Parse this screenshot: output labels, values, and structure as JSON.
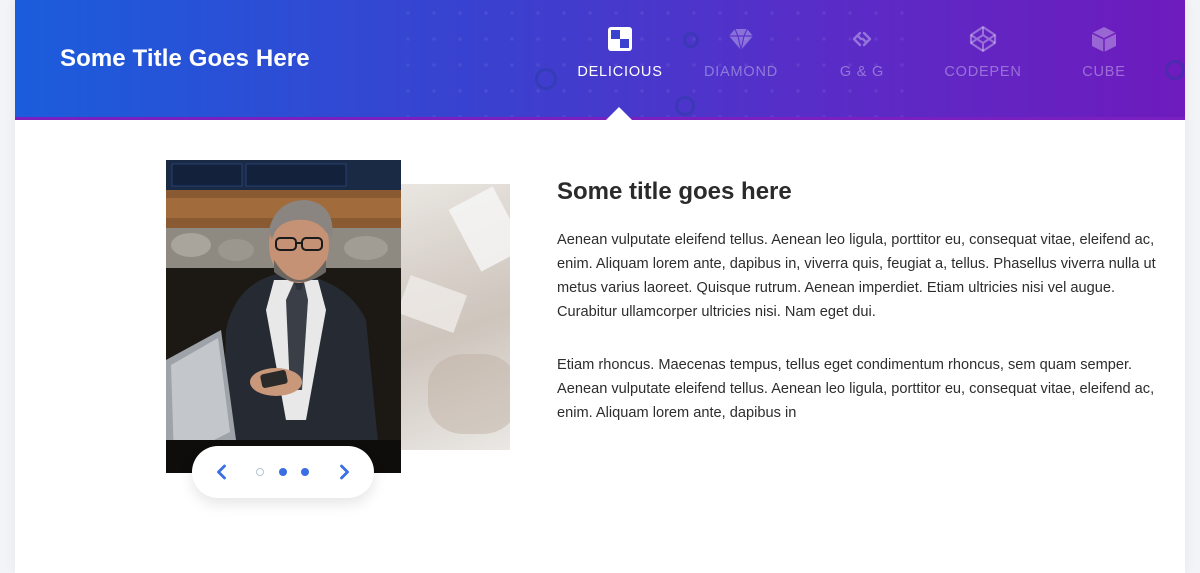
{
  "header": {
    "title": "Some Title Goes Here",
    "tabs": [
      {
        "label": "DELICIOUS",
        "icon": "checker-square-icon",
        "active": true
      },
      {
        "label": "DIAMOND",
        "icon": "diamond-icon",
        "active": false
      },
      {
        "label": "G & G",
        "icon": "chain-link-icon",
        "active": false
      },
      {
        "label": "CODEPEN",
        "icon": "codepen-icon",
        "active": false
      },
      {
        "label": "CUBE",
        "icon": "cube-icon",
        "active": false
      }
    ]
  },
  "slider": {
    "prev_icon": "chevron-left-icon",
    "next_icon": "chevron-right-icon",
    "dots": 3,
    "active_dot": 0
  },
  "content": {
    "title": "Some title goes here",
    "paragraph_1": "Aenean vulputate eleifend tellus. Aenean leo ligula, porttitor eu, consequat vitae, eleifend ac, enim. Aliquam lorem ante, dapibus in, viverra quis, feugiat a, tellus. Phasellus viverra nulla ut metus varius laoreet. Quisque rutrum. Aenean imperdiet. Etiam ultricies nisi vel augue. Curabitur ullamcorper ultricies nisi. Nam eget dui.",
    "paragraph_2": "Etiam rhoncus. Maecenas tempus, tellus eget condimentum rhoncus, sem quam semper. Aenean vulputate eleifend tellus. Aenean leo ligula, porttitor eu, consequat vitae, eleifend ac, enim. Aliquam lorem ante, dapibus in"
  },
  "colors": {
    "accent": "#3a6fe3",
    "header_start": "#1b5ddc",
    "header_end": "#6e1bbd",
    "text": "#2d2d2d"
  }
}
